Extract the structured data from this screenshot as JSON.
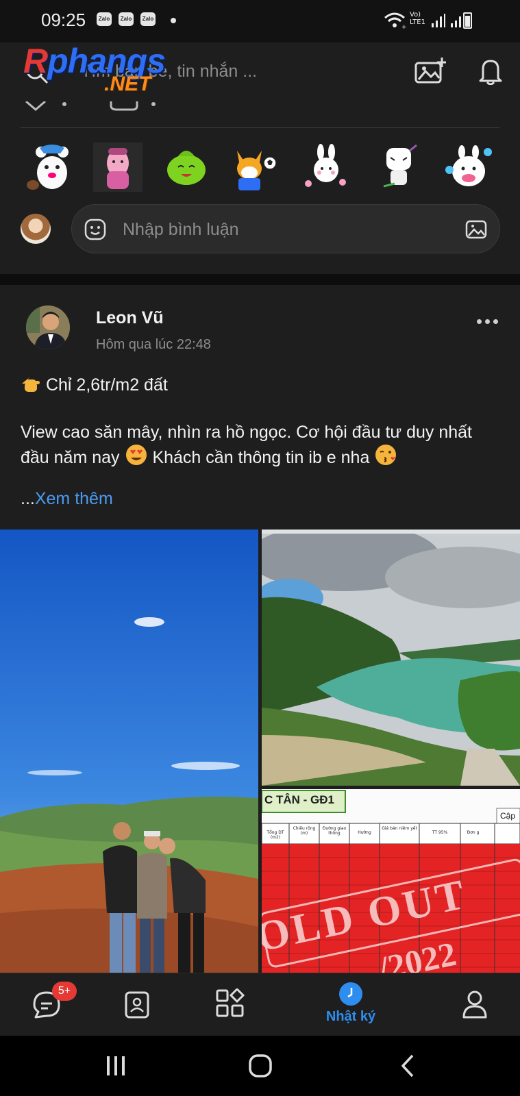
{
  "status_bar": {
    "time": "09:25",
    "notification_icons": [
      "Zalo",
      "Zalo",
      "Zalo"
    ],
    "network": "Vo) LTE1"
  },
  "header": {
    "search_placeholder": "Tìm bạn bè, tin nhắn ...",
    "watermark_main": "Rphangs",
    "watermark_net": ".NET"
  },
  "comment_bar": {
    "placeholder": "Nhập bình luận"
  },
  "post": {
    "author": "Leon Vũ",
    "time": "Hôm qua lúc 22:48",
    "line1": "Chỉ 2,6tr/m2 đất",
    "line2_a": "View cao săn mây, nhìn ra hồ ngọc. Cơ hội đầu tư duy nhất đầu năm nay",
    "line2_b": "Khách cần thông tin ib e nha",
    "see_more_prefix": "...",
    "see_more": "Xem thêm",
    "table_title": "C TÂN - GĐ1",
    "table_col_cap": "Cập",
    "table_headers": [
      "Tổng DT (m2)",
      "Chiều rộng (m)",
      "Đường giao thông",
      "Hướng",
      "Giá bán niêm yết",
      "TT 95%",
      "Đơn g"
    ],
    "sold_out": "OLD OUT",
    "sold_year": "/2022"
  },
  "bottom_nav": {
    "messages_badge": "5+",
    "diary_label": "Nhật ký"
  },
  "colors": {
    "accent": "#2e8ef0",
    "badge": "#e53935",
    "background": "#1e1e1e"
  }
}
